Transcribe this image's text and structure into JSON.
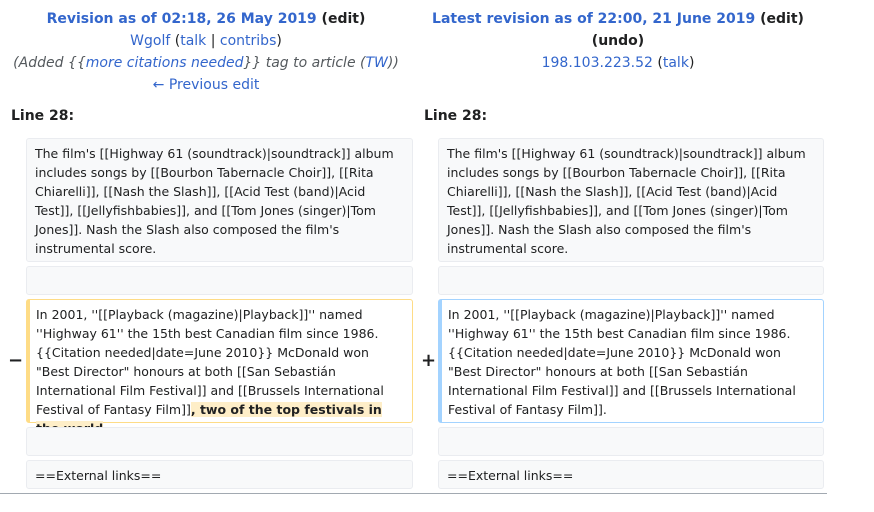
{
  "left": {
    "revision_prefix": "Revision as of 02:18, 26 May 2019",
    "edit_label": "edit",
    "user": "Wgolf",
    "talk_label": "talk",
    "contribs_label": "contribs",
    "summary_pre": "(Added {{",
    "summary_link": "more citations needed",
    "summary_mid": "}} tag to article (",
    "summary_tw": "TW",
    "summary_post": "))",
    "prev_edit": "← Previous edit",
    "line_label": "Line 28:",
    "para1": "The film's [[Highway 61 (soundtrack)|soundtrack]] album includes songs by [[Bourbon Tabernacle Choir]], [[Rita Chiarelli]], [[Nash the Slash]], [[Acid Test (band)|Acid Test]], [[Jellyfishbabies]], and [[Tom Jones (singer)|Tom Jones]]. Nash the Slash also composed the film's instrumental score.",
    "para2_main": "In 2001, ''[[Playback (magazine)|Playback]]'' named ''Highway 61'' the 15th best Canadian film since 1986. {{Citation needed|date=June 2010}} McDonald won \"Best Director\" honours at both [[San Sebastián International Film Festival]] and [[Brussels International Festival of Fantasy Film]]",
    "para2_removed": ", two of the top festivals in the world",
    "para2_end": ".",
    "para3": "==External links==",
    "marker": "−"
  },
  "right": {
    "revision_prefix": "Latest revision as of 22:00, 21 June 2019",
    "edit_label": "edit",
    "undo_label": "undo",
    "user": "198.103.223.52",
    "talk_label": "talk",
    "line_label": "Line 28:",
    "para1": "The film's [[Highway 61 (soundtrack)|soundtrack]] album includes songs by [[Bourbon Tabernacle Choir]], [[Rita Chiarelli]], [[Nash the Slash]], [[Acid Test (band)|Acid Test]], [[Jellyfishbabies]], and [[Tom Jones (singer)|Tom Jones]]. Nash the Slash also composed the film's instrumental score.",
    "para2": "In 2001, ''[[Playback (magazine)|Playback]]'' named ''Highway 61'' the 15th best Canadian film since 1986. {{Citation needed|date=June 2010}} McDonald won \"Best Director\" honours at both [[San Sebastián International Film Festival]] and [[Brussels International Festival of Fantasy Film]].",
    "para3": "==External links==",
    "marker": "+"
  }
}
